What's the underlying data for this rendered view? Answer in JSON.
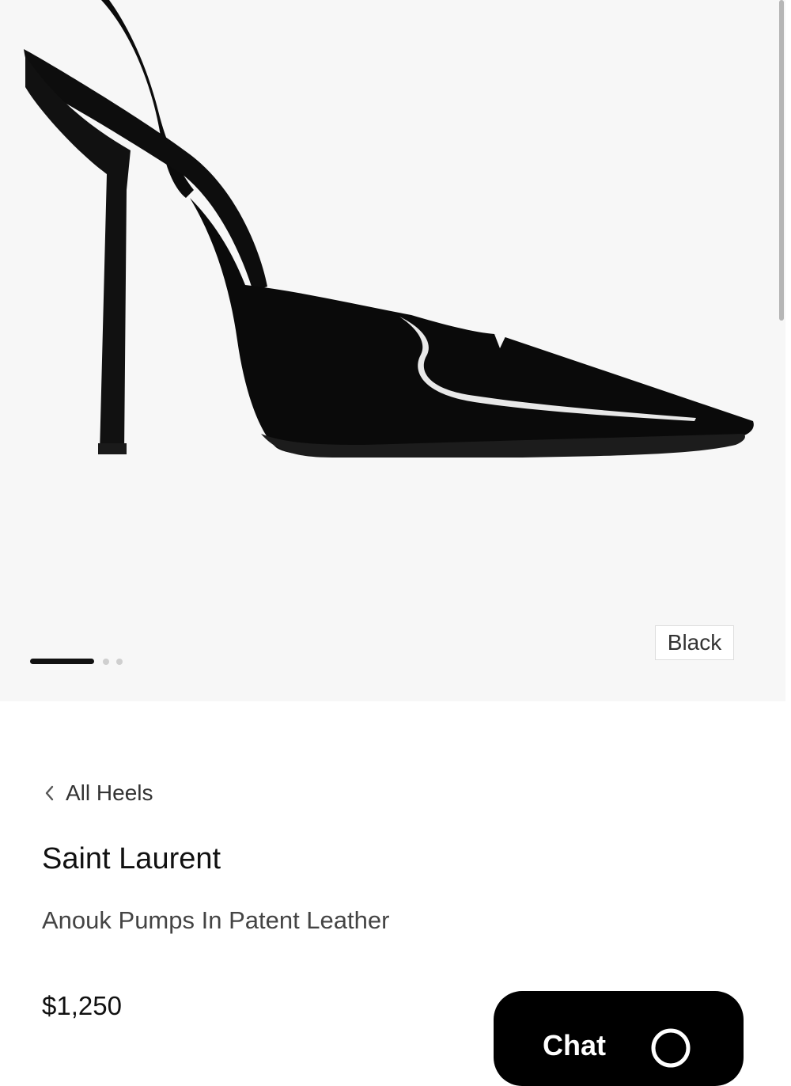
{
  "gallery": {
    "color_tag": "Black",
    "page_count": 3,
    "current_page": 1
  },
  "breadcrumb": {
    "label": "All Heels",
    "icon": "chevron-left-icon"
  },
  "product": {
    "brand": "Saint Laurent",
    "name": "Anouk Pumps In Patent Leather",
    "price": "$1,250"
  },
  "chat": {
    "label": "Chat",
    "icon": "chat-bubble-icon"
  },
  "colors": {
    "gallery_bg": "#f7f7f7",
    "button_bg": "#000000",
    "accent": "#111111"
  }
}
